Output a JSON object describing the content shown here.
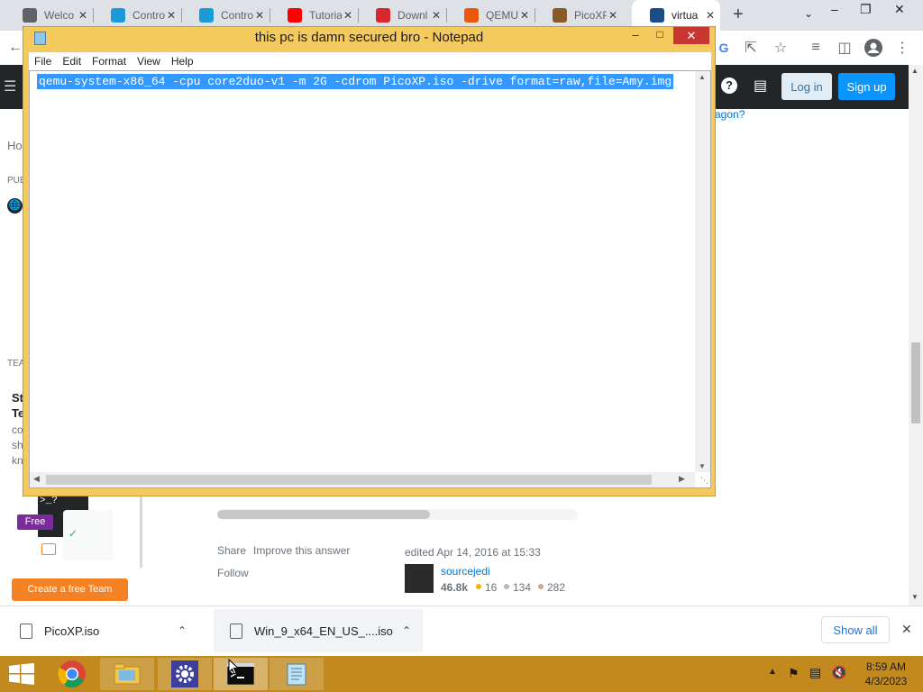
{
  "browser": {
    "tabs": [
      {
        "label": "Welco",
        "icon": "globe-icon",
        "color": "#5f6368"
      },
      {
        "label": "Contro",
        "icon": "monitor-icon",
        "color": "#1a9bd7"
      },
      {
        "label": "Contro",
        "icon": "monitor-icon",
        "color": "#1a9bd7"
      },
      {
        "label": "Tutoria",
        "icon": "youtube-icon",
        "color": "#ff0000"
      },
      {
        "label": "Downl",
        "icon": "mega-icon",
        "color": "#d9272e"
      },
      {
        "label": "QEMU",
        "icon": "qemu-icon",
        "color": "#e8590c"
      },
      {
        "label": "PicoXP",
        "icon": "picoxp-icon",
        "color": "#8a5a2b"
      },
      {
        "label": "virtua",
        "icon": "unix-se-icon",
        "color": "#1b4c8a"
      }
    ],
    "new_tab_glyph": "+",
    "page": {
      "login_label": "Log in",
      "signup_label": "Sign up",
      "sidebar_home": "Ho",
      "sidebar_public": "PUE",
      "sidebar_teams": "TEA",
      "sidebar_st": "St",
      "sidebar_te": "Te",
      "sidebar_co": "co",
      "sidebar_sh": "sh",
      "sidebar_kn": "kn",
      "question_fragment": "agon?",
      "free_badge": "Free",
      "create_team": "Create a free Team",
      "share": "Share",
      "improve": "Improve this answer",
      "follow": "Follow",
      "edited": "edited Apr 14, 2016 at 15:33",
      "user_name": "sourcejedi",
      "reputation": "46.8k",
      "gold": "16",
      "silver": "134",
      "bronze": "282"
    },
    "downloads": [
      {
        "name": "PicoXP.iso"
      },
      {
        "name": "Win_9_x64_EN_US_....iso"
      }
    ],
    "show_all": "Show all"
  },
  "notepad": {
    "title": "this pc is damn secured bro - Notepad",
    "menu": [
      "File",
      "Edit",
      "Format",
      "View",
      "Help"
    ],
    "content": "qemu-system-x86_64 -cpu core2duo-v1 -m 2G -cdrom PicoXP.iso -drive format=raw,file=Amy.img"
  },
  "taskbar": {
    "time": "8:59 AM",
    "date": "4/3/2023",
    "colors": {
      "bar": "#c28a1e",
      "start": "#ffffff"
    }
  }
}
